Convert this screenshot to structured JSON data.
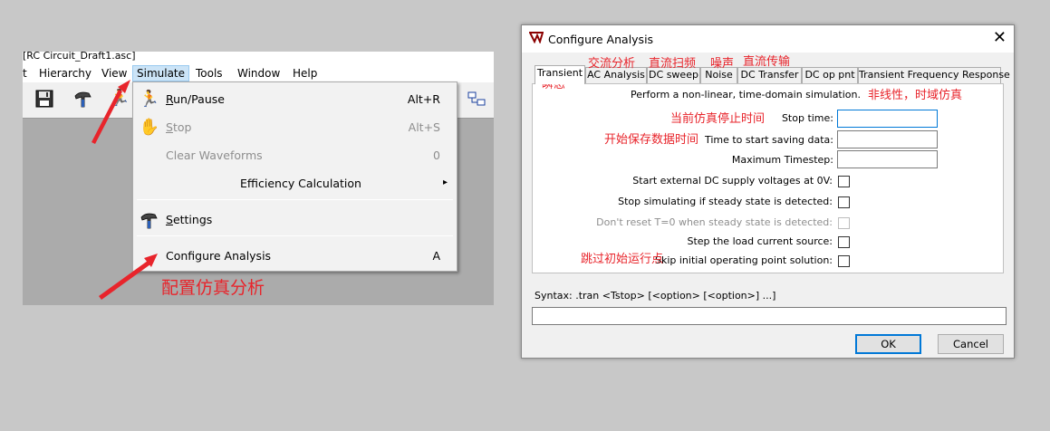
{
  "ltspice": {
    "title_fragment": "[RC Circuit_Draft1.asc]",
    "menubar": [
      "t",
      "Hierarchy",
      "View",
      "Simulate",
      "Tools",
      "Window",
      "Help"
    ],
    "simulate_menu": {
      "run_pause": {
        "label": "Run/Pause",
        "shortcut": "Alt+R",
        "icon": "running-man-icon"
      },
      "stop": {
        "label": "Stop",
        "shortcut": "Alt+S",
        "icon": "halt-hand-icon"
      },
      "clear_waveforms": {
        "label": "Clear Waveforms",
        "shortcut": "0"
      },
      "efficiency": {
        "label": "Efficiency Calculation",
        "submenu_arrow": "▸"
      },
      "settings": {
        "label": "Settings",
        "icon": "hammer-icon"
      },
      "configure_analysis": {
        "label": "Configure Analysis",
        "shortcut": "A"
      }
    }
  },
  "annotations": {
    "configure": "配置仿真分析",
    "transient": "瞬态",
    "ac": "交流分析",
    "dc_sweep": "直流扫频",
    "noise": "噪声",
    "dc_transfer": "直流传输",
    "nonlinear": "非线性，时域仿真",
    "stop_time": "当前仿真停止时间",
    "start_saving": "开始保存数据时间",
    "skip_op": "跳过初始运行点",
    "color": "#e8242b"
  },
  "dialog": {
    "title": "Configure Analysis",
    "close_glyph": "✕",
    "tabs": [
      "Transient",
      "AC Analysis",
      "DC sweep",
      "Noise",
      "DC Transfer",
      "DC op pnt",
      "Transient Frequency Response"
    ],
    "description": "Perform a non-linear, time-domain simulation.",
    "fields": {
      "stop_time": {
        "label": "Stop time:",
        "value": ""
      },
      "start_saving": {
        "label": "Time to start saving data:",
        "value": ""
      },
      "max_timestep": {
        "label": "Maximum Timestep:",
        "value": ""
      }
    },
    "checks": {
      "ext_dc": {
        "label": "Start external DC supply voltages at 0V:",
        "checked": false
      },
      "steady_stop": {
        "label": "Stop simulating if steady state is detected:",
        "checked": false
      },
      "no_reset": {
        "label": "Don't reset T=0 when steady state is detected:",
        "checked": false,
        "disabled": true
      },
      "step_load": {
        "label": "Step the load current source:",
        "checked": false
      },
      "skip_op": {
        "label": "Skip initial operating point solution:",
        "checked": false
      }
    },
    "syntax": "Syntax:  .tran <Tstop> [<option> [<option>] ...]",
    "syntax_value": "",
    "ok_label": "OK",
    "cancel_label": "Cancel"
  }
}
